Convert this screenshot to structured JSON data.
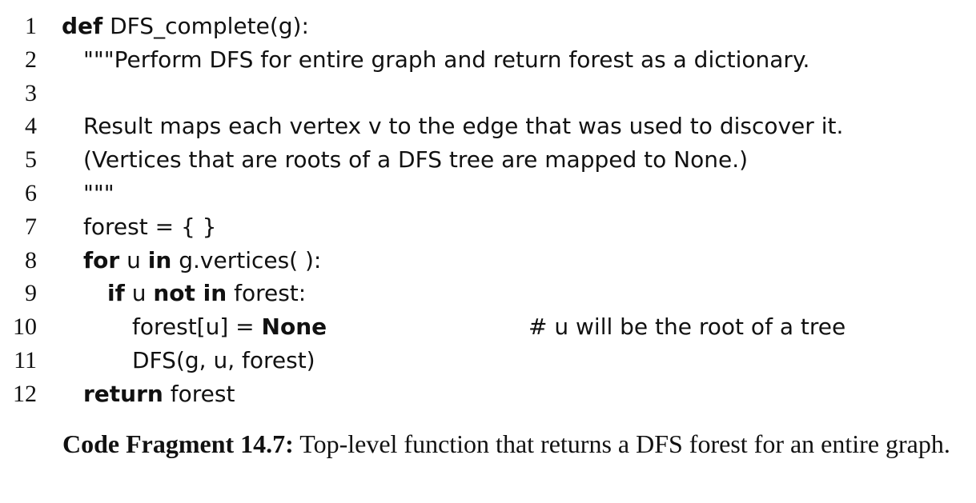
{
  "code": {
    "line_numbers": [
      "1",
      "2",
      "3",
      "4",
      "5",
      "6",
      "7",
      "8",
      "9",
      "10",
      "11",
      "12"
    ],
    "l1": {
      "kw": "def",
      "text": "DFS_complete(g):"
    },
    "l2": {
      "text": "\"\"\"Perform DFS for entire graph and return forest as a dictionary."
    },
    "l4": {
      "text": "Result maps each vertex v to the edge that was used to discover it."
    },
    "l5": {
      "text": "(Vertices that are roots of a DFS tree are mapped to None.)"
    },
    "l6": {
      "text": "\"\"\""
    },
    "l7": {
      "text": "forest = { }"
    },
    "l8": {
      "kw1": "for",
      "t1": "u",
      "kw2": "in",
      "t2": "g.vertices( ):"
    },
    "l9": {
      "kw1": "if",
      "t1": "u",
      "kw2": "not in",
      "t2": "forest:"
    },
    "l10": {
      "t1": "forest[u] =",
      "kw": "None",
      "comment": "# u will be the root of a tree"
    },
    "l11": {
      "text": "DFS(g, u, forest)"
    },
    "l12": {
      "kw": "return",
      "text": "forest"
    }
  },
  "caption": {
    "label": "Code Fragment 14.7:",
    "text": "Top-level function that returns a DFS forest for an entire graph."
  }
}
